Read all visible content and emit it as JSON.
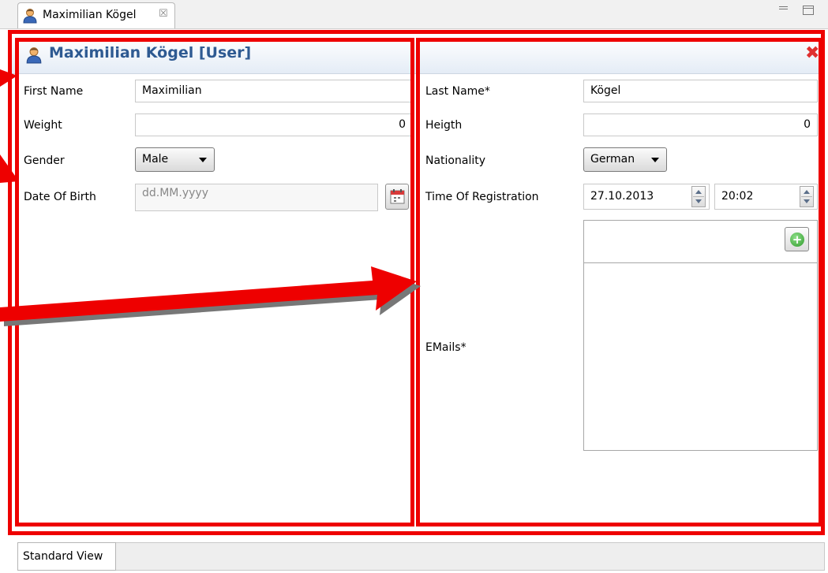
{
  "tab": {
    "label": "Maximilian Kögel",
    "close_glyph": "☒"
  },
  "header": {
    "title": "Maximilian Kögel [User]",
    "close_glyph": "✖"
  },
  "left": {
    "first_name_label": "First Name",
    "first_name_value": "Maximilian",
    "weight_label": "Weight",
    "weight_value": "0",
    "gender_label": "Gender",
    "gender_value": "Male",
    "dob_label": "Date Of Birth",
    "dob_placeholder": "dd.MM.yyyy"
  },
  "right": {
    "last_name_label": "Last Name*",
    "last_name_value": "Kögel",
    "height_label": "Heigth",
    "height_value": "0",
    "nationality_label": "Nationality",
    "nationality_value": "German",
    "registration_label": "Time Of Registration",
    "registration_date": "27.10.2013",
    "registration_time": "20:02",
    "emails_label": "EMails*"
  },
  "bottom": {
    "tab_label": "Standard View"
  },
  "colors": {
    "highlight": "#ee0000",
    "title": "#2e5a92",
    "close": "#e03030",
    "add": "#2f9a2b"
  },
  "icons": [
    "user-icon",
    "close-icon",
    "minimize-icon",
    "maximize-icon",
    "calendar-icon",
    "spinner-icon",
    "add-icon"
  ]
}
